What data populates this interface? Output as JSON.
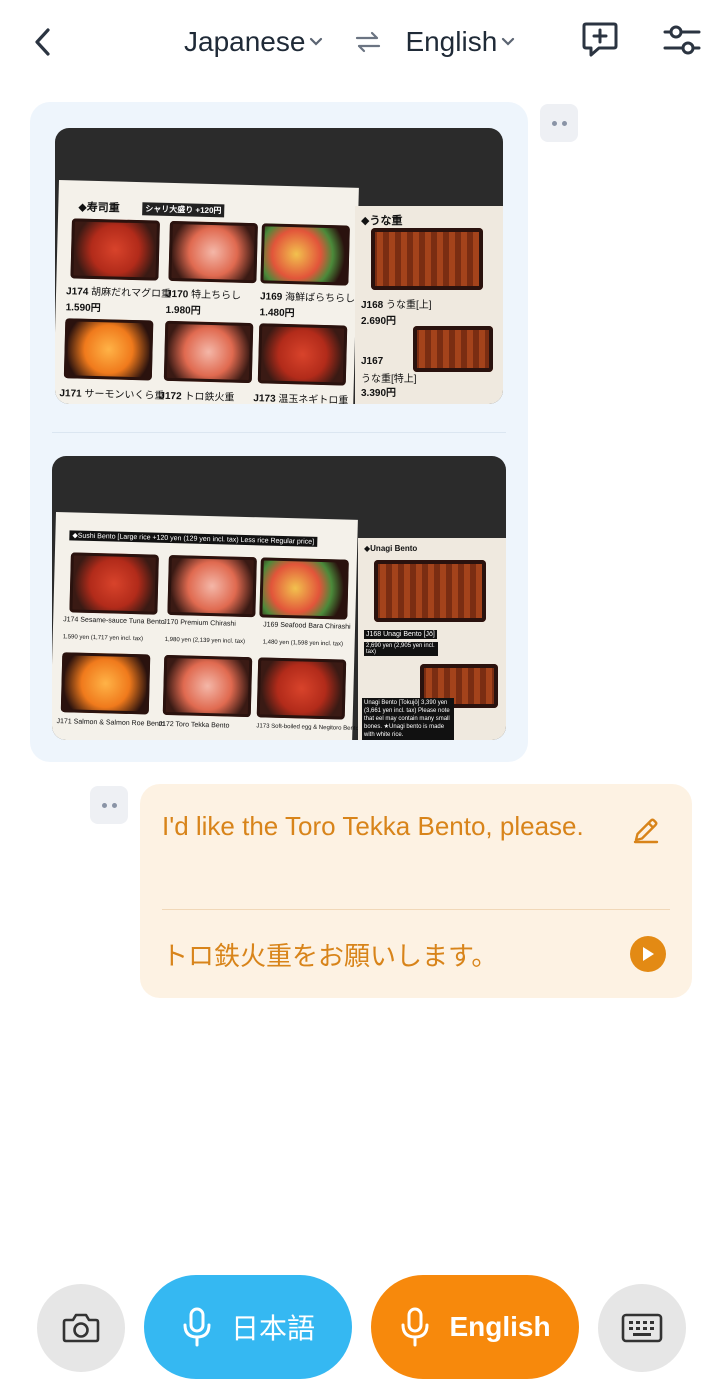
{
  "header": {
    "source_language": "Japanese",
    "target_language": "English"
  },
  "menu_photo_original": {
    "section_sushi": "◆寿司重",
    "section_sushi_note": "シャリ大盛り +120円",
    "section_unagi": "◆うな重",
    "items": [
      {
        "code": "J174",
        "name": "胡麻だれマグロ重",
        "price": "1.590円"
      },
      {
        "code": "J170",
        "name": "特上ちらし",
        "price": "1.980円"
      },
      {
        "code": "J169",
        "name": "海鮮ばらちらし",
        "price": "1.480円"
      },
      {
        "code": "J171",
        "name": "サーモンいくら重",
        "price": ""
      },
      {
        "code": "J172",
        "name": "トロ鉄火重",
        "price": ""
      },
      {
        "code": "J173",
        "name": "温玉ネギトロ重",
        "price": ""
      },
      {
        "code": "J168",
        "name": "うな重[上]",
        "price": "2.690円"
      },
      {
        "code": "J167",
        "name": "うな重[特上]",
        "price": "3.390円"
      }
    ]
  },
  "menu_photo_translated": {
    "section_sushi": "◆Sushi Bento [Large rice +120 yen (129 yen incl. tax) Less rice Regular price]",
    "section_unagi": "◆Unagi Bento",
    "items": [
      {
        "name": "J174 Sesame-sauce Tuna Bento",
        "price": "1,590 yen (1,717 yen incl. tax)"
      },
      {
        "name": "J170 Premium Chirashi",
        "price": "1,980 yen (2,139 yen incl. tax)"
      },
      {
        "name": "J169 Seafood Bara Chirashi",
        "price": "1,480 yen (1,598 yen incl. tax)"
      },
      {
        "name": "J171 Salmon & Salmon Roe Bento",
        "price": ""
      },
      {
        "name": "J172 Toro Tekka Bento",
        "price": ""
      },
      {
        "name": "J173 Soft-boiled egg & Negitoro Bento",
        "price": ""
      },
      {
        "name": "J168 Unagi Bento [Jō]",
        "price": "2,690 yen (2,905 yen incl. tax)"
      },
      {
        "name": "Unagi Bento [Tokujō] 3,390 yen (3,661 yen incl. tax) Please note that eel may contain many small bones. ★Unagi bento is made with white rice.",
        "price": ""
      }
    ]
  },
  "message": {
    "source_text": "I'd like the Toro Tekka Bento, please.",
    "translated_text": "トロ鉄火重をお願いします。"
  },
  "bottom_bar": {
    "japanese_mic_label": "日本語",
    "english_mic_label": "English"
  },
  "colors": {
    "japanese_pill": "#35b8f2",
    "english_pill": "#f7890c",
    "message_text": "#d8841a",
    "message_bg": "#fdf2e3",
    "image_bubble_bg": "#eef5fc"
  }
}
